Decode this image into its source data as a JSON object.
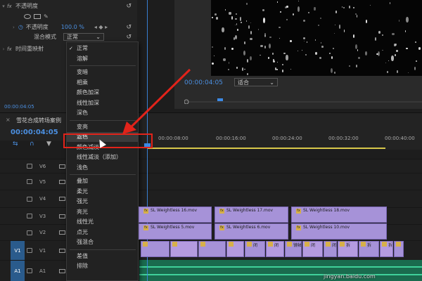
{
  "effect_controls": {
    "opacity_label": "不透明度",
    "opacity_param_label": "不透明度",
    "opacity_value": "100.0 %",
    "blend_label": "混合模式",
    "blend_value": "正常",
    "time_remap_label": "时间重映射",
    "timecode": "00:00:04:05",
    "fx_glyph": "fx"
  },
  "program_monitor": {
    "timecode": "00:00:04:05",
    "fit_value": "适合"
  },
  "timeline": {
    "sequence_name": "雪花合成转场案例",
    "timecode": "00:00:04:05",
    "ruler_ticks": [
      "00:00:08:00",
      "00:00:16:00",
      "00:00:24:00",
      "00:00:32:00",
      "00:00:40:00"
    ],
    "tracks": [
      "V6",
      "V5",
      "V4",
      "V3",
      "V2",
      "V1",
      "A1"
    ],
    "target_v": "V1",
    "target_a": "A1",
    "clips": {
      "v3_a": "SL Weightless 16.mov",
      "v3_b": "SL Weightless 17.mov",
      "v3_c": "SL Weightless 18.mov",
      "v2_a": "SL Weightless 5.mov",
      "v2_b": "SL Weightless 6.mov",
      "v2_c": "SL Weightless 10.mov",
      "v1_labels": [
        "闭",
        "闭",
        "镜轴段",
        "闭",
        "闭",
        "拆",
        "拆",
        "拆"
      ]
    }
  },
  "blend_menu": {
    "items_group1": [
      "正常",
      "溶解"
    ],
    "items_group2": [
      "变暗",
      "相乘",
      "颜色加深",
      "线性加深",
      "深色"
    ],
    "items_group3": [
      "变亮",
      "滤色",
      "颜色减淡",
      "线性减淡（添加）",
      "浅色"
    ],
    "items_group4": [
      "叠加",
      "柔光",
      "强光",
      "亮光",
      "线性光",
      "点光",
      "强混合"
    ],
    "items_group5": [
      "差值",
      "排除"
    ],
    "selected": "正常",
    "highlighted": "滤色"
  },
  "watermark": "jingyan.baidu.com",
  "colors": {
    "accent_blue": "#4b8fe0",
    "clip_purple": "#a692d8",
    "annotation_red": "#e2231a"
  }
}
